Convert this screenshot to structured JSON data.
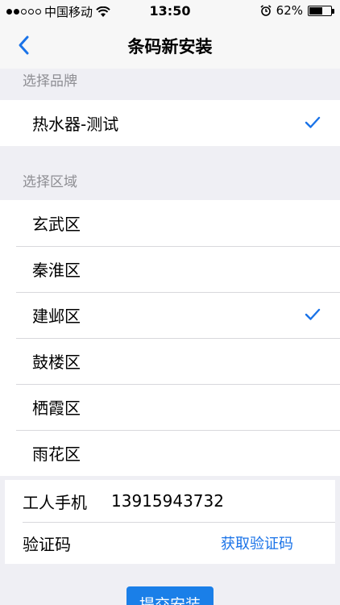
{
  "status_bar": {
    "carrier": "中国移动",
    "time": "13:50",
    "battery_percent_text": "62%",
    "battery_level": 0.62
  },
  "nav": {
    "title": "条码新安装",
    "back_icon": "chevron-left-icon"
  },
  "brand_section": {
    "header": "选择品牌",
    "items": [
      {
        "label": "热水器-测试",
        "selected": true
      }
    ]
  },
  "region_section": {
    "header": "选择区域",
    "items": [
      {
        "label": "玄武区",
        "selected": false
      },
      {
        "label": "秦淮区",
        "selected": false
      },
      {
        "label": "建邺区",
        "selected": true
      },
      {
        "label": "鼓楼区",
        "selected": false
      },
      {
        "label": "栖霞区",
        "selected": false
      },
      {
        "label": "雨花区",
        "selected": false
      }
    ]
  },
  "form": {
    "phone_label": "工人手机",
    "phone_value": "13915943732",
    "code_label": "验证码",
    "get_code_label": "获取验证码"
  },
  "submit_label": "提交安装",
  "colors": {
    "accent": "#1a73e8",
    "button": "#1a7fe8",
    "background": "#efeff4"
  }
}
